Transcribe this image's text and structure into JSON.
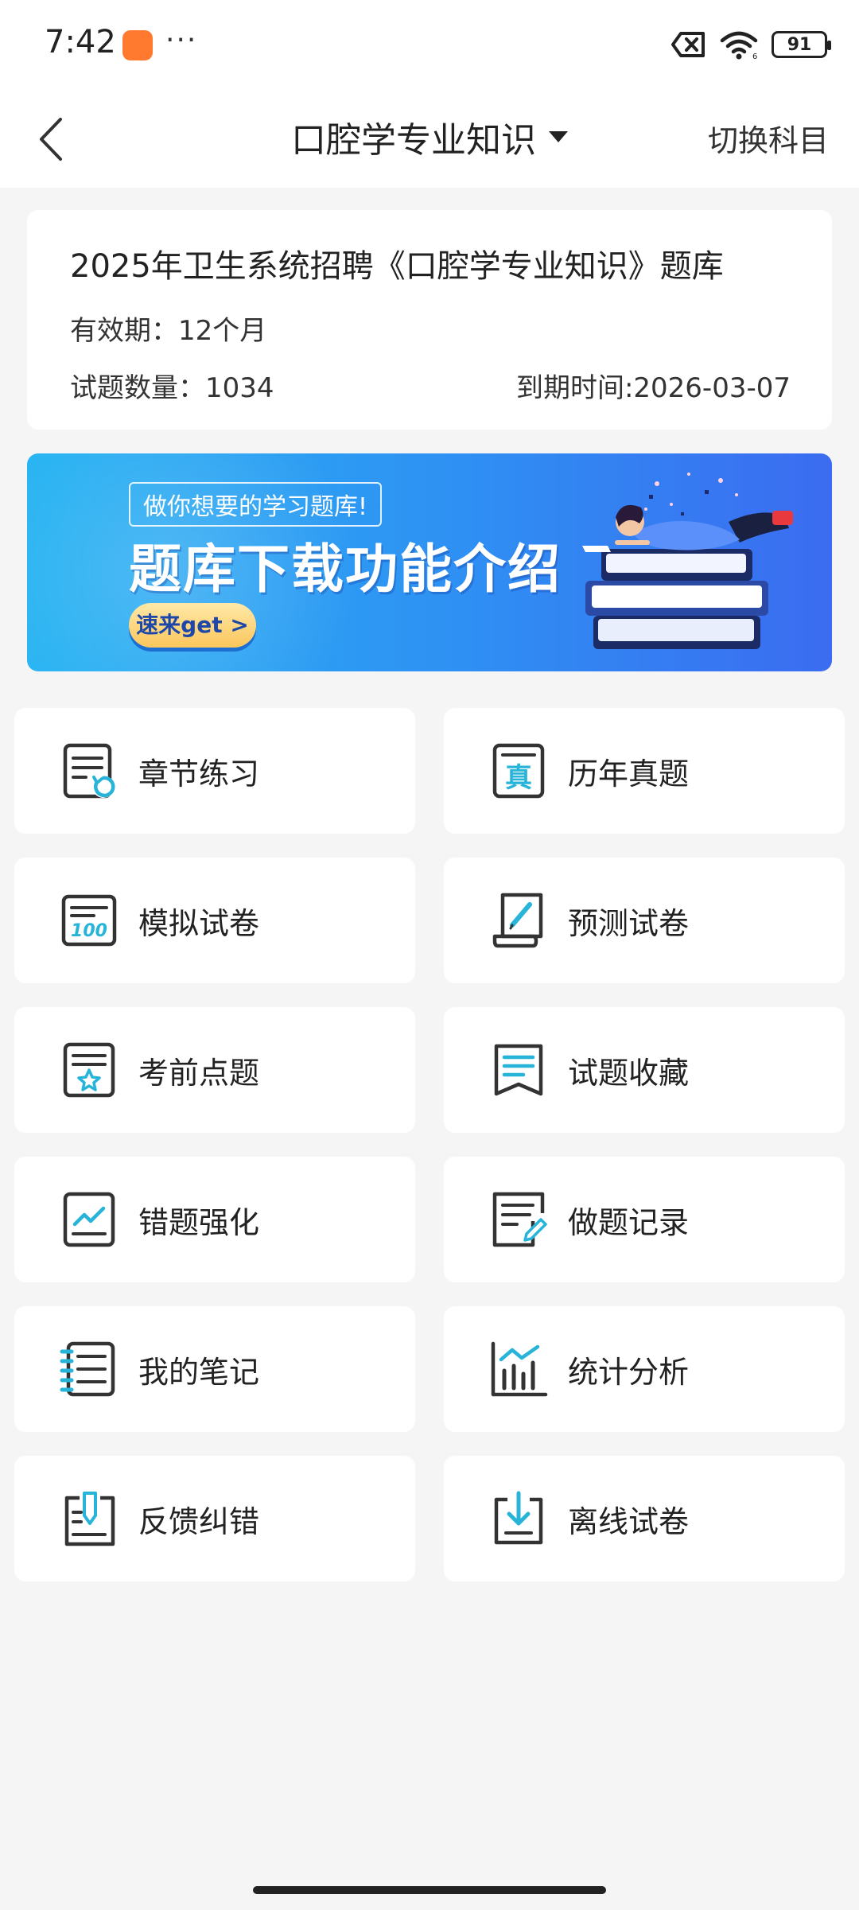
{
  "status_bar": {
    "time": "7:42",
    "more": "···",
    "battery": "91"
  },
  "header": {
    "title": "口腔学专业知识",
    "switch_subject": "切换科目"
  },
  "info_card": {
    "title": "2025年卫生系统招聘《口腔学专业知识》题库",
    "validity": "有效期：12个月",
    "question_count": "试题数量：1034",
    "expiry": "到期时间:2026-03-07"
  },
  "banner": {
    "tag": "做你想要的学习题库!",
    "headline": "题库下载功能介绍",
    "cta": "速来get >"
  },
  "menu": {
    "items": [
      {
        "label": "章节练习",
        "icon": "chapter-practice-icon"
      },
      {
        "label": "历年真题",
        "icon": "past-exams-icon"
      },
      {
        "label": "模拟试卷",
        "icon": "mock-exam-icon"
      },
      {
        "label": "预测试卷",
        "icon": "prediction-exam-icon"
      },
      {
        "label": "考前点题",
        "icon": "pre-exam-tips-icon"
      },
      {
        "label": "试题收藏",
        "icon": "favorites-icon"
      },
      {
        "label": "错题强化",
        "icon": "wrong-questions-icon"
      },
      {
        "label": "做题记录",
        "icon": "practice-history-icon"
      },
      {
        "label": "我的笔记",
        "icon": "notes-icon"
      },
      {
        "label": "统计分析",
        "icon": "statistics-icon"
      },
      {
        "label": "反馈纠错",
        "icon": "feedback-icon"
      },
      {
        "label": "离线试卷",
        "icon": "offline-exam-icon"
      }
    ]
  },
  "colors": {
    "accent": "#27b4d8",
    "icon_dark": "#333333",
    "background": "#f5f5f5",
    "banner_start": "#27b4f2",
    "banner_end": "#3b6cf1"
  }
}
